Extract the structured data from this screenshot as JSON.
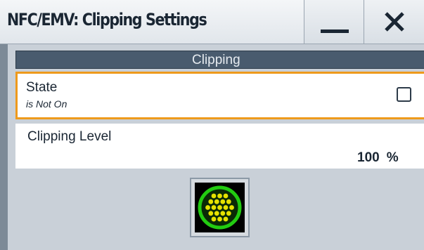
{
  "window": {
    "title": "NFC/EMV: Clipping Settings",
    "minimize_icon": "minimize-icon",
    "close_icon": "close-icon"
  },
  "section": {
    "title": "Clipping"
  },
  "state": {
    "label": "State",
    "status": "is Not On",
    "checked": false
  },
  "clipping_level": {
    "label": "Clipping Level",
    "value": "100",
    "unit": "%"
  },
  "action_button": {
    "icon": "clipping-globe-icon"
  },
  "colors": {
    "highlight_border": "#ee9a1c",
    "section_header": "#495b6e",
    "panel_background": "#c9d0d8",
    "icon_ring": "#22cc11",
    "icon_dots": "#e6e200"
  }
}
